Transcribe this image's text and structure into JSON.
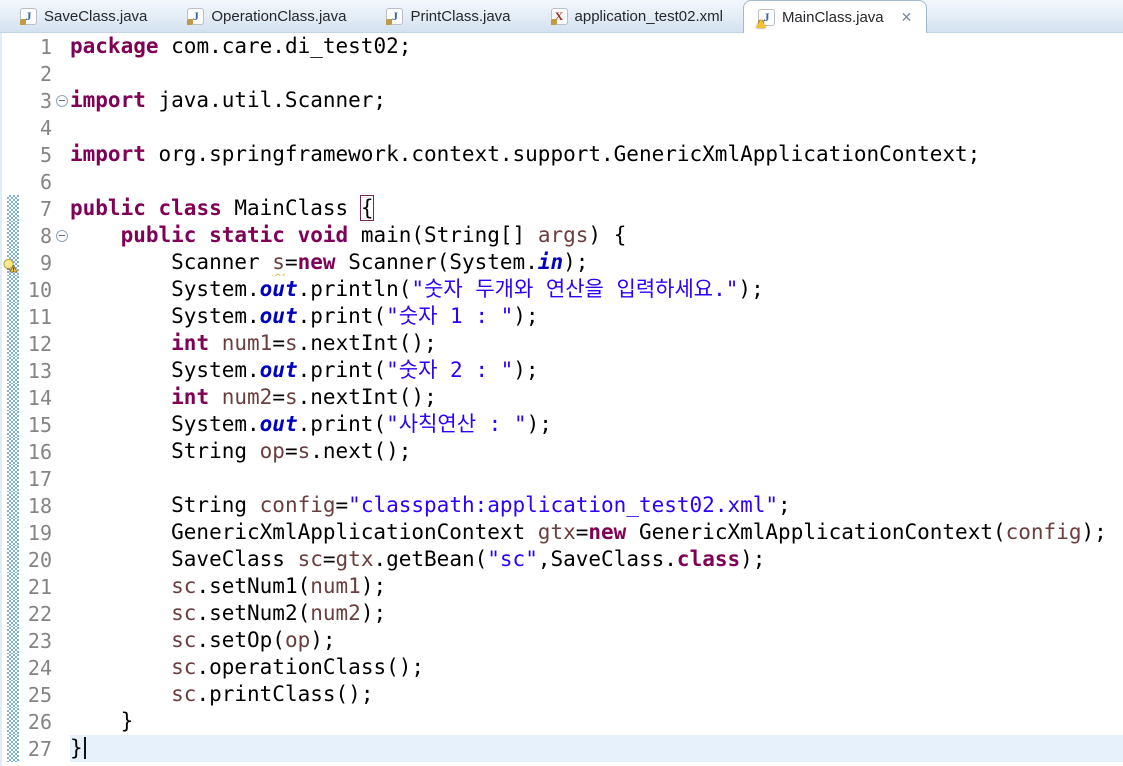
{
  "tabs": [
    {
      "label": "SaveClass.java",
      "icon": "java-file-icon",
      "icon_letter": "J",
      "active": false
    },
    {
      "label": "OperationClass.java",
      "icon": "java-file-icon",
      "icon_letter": "J",
      "active": false
    },
    {
      "label": "PrintClass.java",
      "icon": "java-file-icon",
      "icon_letter": "J",
      "active": false
    },
    {
      "label": "application_test02.xml",
      "icon": "xml-file-icon",
      "icon_letter": "X",
      "active": false
    },
    {
      "label": "MainClass.java",
      "icon": "java-file-warning-icon",
      "icon_letter": "J",
      "active": true,
      "close_glyph": "✕"
    }
  ],
  "editor": {
    "language": "java",
    "current_line": 27,
    "caret_line": 27,
    "warning_lines": [
      9
    ],
    "folded_markers": [
      3,
      8
    ],
    "changed_lines_from": 7,
    "lines": [
      {
        "n": 1,
        "segs": [
          [
            "k",
            "package"
          ],
          [
            "p",
            " com.care.di_test02;"
          ]
        ]
      },
      {
        "n": 2,
        "segs": []
      },
      {
        "n": 3,
        "segs": [
          [
            "k",
            "import"
          ],
          [
            "p",
            " java.util.Scanner;"
          ]
        ]
      },
      {
        "n": 4,
        "segs": []
      },
      {
        "n": 5,
        "segs": [
          [
            "k",
            "import"
          ],
          [
            "p",
            " org.springframework.context.support.GenericXmlApplicationContext;"
          ]
        ]
      },
      {
        "n": 6,
        "segs": []
      },
      {
        "n": 7,
        "segs": [
          [
            "k",
            "public"
          ],
          [
            "p",
            " "
          ],
          [
            "k",
            "class"
          ],
          [
            "p",
            " MainClass "
          ],
          [
            "x",
            "{"
          ]
        ]
      },
      {
        "n": 8,
        "segs": [
          [
            "p",
            "    "
          ],
          [
            "k",
            "public"
          ],
          [
            "p",
            " "
          ],
          [
            "k",
            "static"
          ],
          [
            "p",
            " "
          ],
          [
            "k",
            "void"
          ],
          [
            "p",
            " main(String[] "
          ],
          [
            "v",
            "args"
          ],
          [
            "p",
            ") {"
          ]
        ]
      },
      {
        "n": 9,
        "segs": [
          [
            "p",
            "        Scanner "
          ],
          [
            "vw",
            "s"
          ],
          [
            "p",
            "="
          ],
          [
            "k",
            "new"
          ],
          [
            "p",
            " Scanner(System."
          ],
          [
            "f",
            "in"
          ],
          [
            "p",
            ");"
          ]
        ]
      },
      {
        "n": 10,
        "segs": [
          [
            "p",
            "        System."
          ],
          [
            "f",
            "out"
          ],
          [
            "p",
            ".println("
          ],
          [
            "s",
            "\"숫자 두개와 연산을 입력하세요.\""
          ],
          [
            "p",
            ");"
          ]
        ]
      },
      {
        "n": 11,
        "segs": [
          [
            "p",
            "        System."
          ],
          [
            "f",
            "out"
          ],
          [
            "p",
            ".print("
          ],
          [
            "s",
            "\"숫자 1 : \""
          ],
          [
            "p",
            ");"
          ]
        ]
      },
      {
        "n": 12,
        "segs": [
          [
            "p",
            "        "
          ],
          [
            "k",
            "int"
          ],
          [
            "p",
            " "
          ],
          [
            "v",
            "num1"
          ],
          [
            "p",
            "="
          ],
          [
            "v",
            "s"
          ],
          [
            "p",
            ".nextInt();"
          ]
        ]
      },
      {
        "n": 13,
        "segs": [
          [
            "p",
            "        System."
          ],
          [
            "f",
            "out"
          ],
          [
            "p",
            ".print("
          ],
          [
            "s",
            "\"숫자 2 : \""
          ],
          [
            "p",
            ");"
          ]
        ]
      },
      {
        "n": 14,
        "segs": [
          [
            "p",
            "        "
          ],
          [
            "k",
            "int"
          ],
          [
            "p",
            " "
          ],
          [
            "v",
            "num2"
          ],
          [
            "p",
            "="
          ],
          [
            "v",
            "s"
          ],
          [
            "p",
            ".nextInt();"
          ]
        ]
      },
      {
        "n": 15,
        "segs": [
          [
            "p",
            "        System."
          ],
          [
            "f",
            "out"
          ],
          [
            "p",
            ".print("
          ],
          [
            "s",
            "\"사칙연산 : \""
          ],
          [
            "p",
            ");"
          ]
        ]
      },
      {
        "n": 16,
        "segs": [
          [
            "p",
            "        String "
          ],
          [
            "v",
            "op"
          ],
          [
            "p",
            "="
          ],
          [
            "v",
            "s"
          ],
          [
            "p",
            ".next();"
          ]
        ]
      },
      {
        "n": 17,
        "segs": []
      },
      {
        "n": 18,
        "segs": [
          [
            "p",
            "        String "
          ],
          [
            "v",
            "config"
          ],
          [
            "p",
            "="
          ],
          [
            "s",
            "\"classpath:application_test02.xml\""
          ],
          [
            "p",
            ";"
          ]
        ]
      },
      {
        "n": 19,
        "segs": [
          [
            "p",
            "        GenericXmlApplicationContext "
          ],
          [
            "v",
            "gtx"
          ],
          [
            "p",
            "="
          ],
          [
            "k",
            "new"
          ],
          [
            "p",
            " GenericXmlApplicationContext("
          ],
          [
            "v",
            "config"
          ],
          [
            "p",
            ");"
          ]
        ]
      },
      {
        "n": 20,
        "segs": [
          [
            "p",
            "        SaveClass "
          ],
          [
            "v",
            "sc"
          ],
          [
            "p",
            "="
          ],
          [
            "v",
            "gtx"
          ],
          [
            "p",
            ".getBean("
          ],
          [
            "s",
            "\"sc\""
          ],
          [
            "p",
            ",SaveClass."
          ],
          [
            "k",
            "class"
          ],
          [
            "p",
            ");"
          ]
        ]
      },
      {
        "n": 21,
        "segs": [
          [
            "p",
            "        "
          ],
          [
            "v",
            "sc"
          ],
          [
            "p",
            ".setNum1("
          ],
          [
            "v",
            "num1"
          ],
          [
            "p",
            ");"
          ]
        ]
      },
      {
        "n": 22,
        "segs": [
          [
            "p",
            "        "
          ],
          [
            "v",
            "sc"
          ],
          [
            "p",
            ".setNum2("
          ],
          [
            "v",
            "num2"
          ],
          [
            "p",
            ");"
          ]
        ]
      },
      {
        "n": 23,
        "segs": [
          [
            "p",
            "        "
          ],
          [
            "v",
            "sc"
          ],
          [
            "p",
            ".setOp("
          ],
          [
            "v",
            "op"
          ],
          [
            "p",
            ");"
          ]
        ]
      },
      {
        "n": 24,
        "segs": [
          [
            "p",
            "        "
          ],
          [
            "v",
            "sc"
          ],
          [
            "p",
            ".operationClass();"
          ]
        ]
      },
      {
        "n": 25,
        "segs": [
          [
            "p",
            "        "
          ],
          [
            "v",
            "sc"
          ],
          [
            "p",
            ".printClass();"
          ]
        ]
      },
      {
        "n": 26,
        "segs": [
          [
            "p",
            "    }"
          ]
        ]
      },
      {
        "n": 27,
        "segs": [
          [
            "p",
            "}"
          ]
        ],
        "caret": true
      }
    ]
  },
  "colors": {
    "keyword": "#7F0055",
    "string": "#2A00FF",
    "static_field": "#0000C0",
    "local_variable": "#6A3E3E",
    "line_number": "#848484",
    "current_line_bg": "#E6F1FC",
    "diff_marker": "#7FB2D9",
    "tab_bar_bg_top": "#F2F7FC",
    "tab_bar_bg_bottom": "#D3E1F0",
    "active_tab_bg": "#FFFFFF",
    "squiggle_warning": "#D9B94D",
    "bracket_match_outline": "#7D2053"
  }
}
